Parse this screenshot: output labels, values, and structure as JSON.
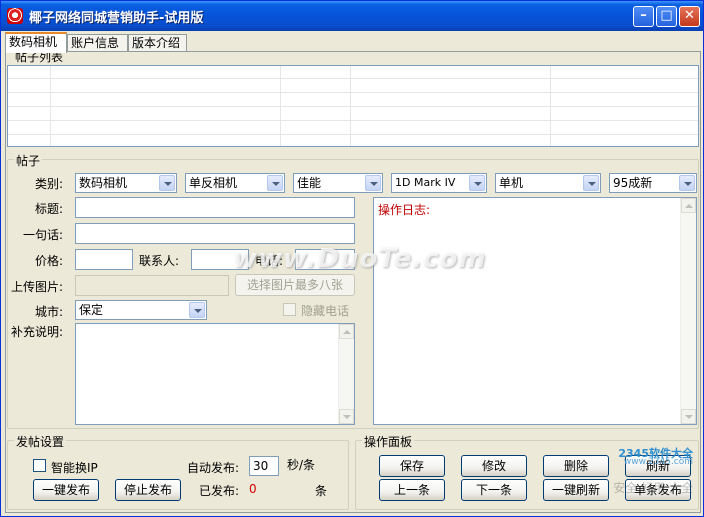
{
  "window": {
    "title": "椰子网络同城营销助手-试用版"
  },
  "tabs": [
    {
      "label": "数码相机",
      "active": true
    },
    {
      "label": "账户信息",
      "active": false
    },
    {
      "label": "版本介绍",
      "active": false
    }
  ],
  "post_list": {
    "legend": "帖子列表"
  },
  "post": {
    "legend": "帖子",
    "category_label": "类别:",
    "categories": [
      "数码相机",
      "单反相机",
      "佳能",
      "1D Mark IV",
      "单机",
      "95成新"
    ],
    "title_label": "标题:",
    "title_value": "",
    "tagline_label": "一句话:",
    "tagline_value": "",
    "price_label": "价格:",
    "price_value": "",
    "contact_label": "联系人:",
    "contact_value": "",
    "phone_label": "电话:",
    "phone_value": "",
    "upload_label": "上传图片:",
    "upload_value": "",
    "select_image_button": "选择图片最多八张",
    "city_label": "城市:",
    "city_value": "保定",
    "hide_phone_label": "隐藏电话",
    "extra_label": "补充说明:",
    "log_title": "操作日志:"
  },
  "posting_settings": {
    "legend": "发帖设置",
    "smart_ip_label": "智能换IP",
    "auto_post_label": "自动发布:",
    "auto_post_value": "30",
    "auto_post_unit": "秒/条",
    "one_click_post_button": "一键发布",
    "stop_post_button": "停止发布",
    "posted_label": "已发布:",
    "posted_count": "0",
    "posted_unit": "条"
  },
  "control_panel": {
    "legend": "操作面板",
    "save_button": "保存",
    "edit_button": "修改",
    "delete_button": "删除",
    "refresh_button": "刷新",
    "prev_button": "上一条",
    "next_button": "下一条",
    "one_click_refresh_button": "一键刷新",
    "single_post_button": "单条发布"
  },
  "watermark": {
    "text": "www.DuoTe.com"
  },
  "corner_logo": {
    "line1": "2345软件大全",
    "line2": "www.2345.com",
    "line3": "安全 好用 大全"
  }
}
